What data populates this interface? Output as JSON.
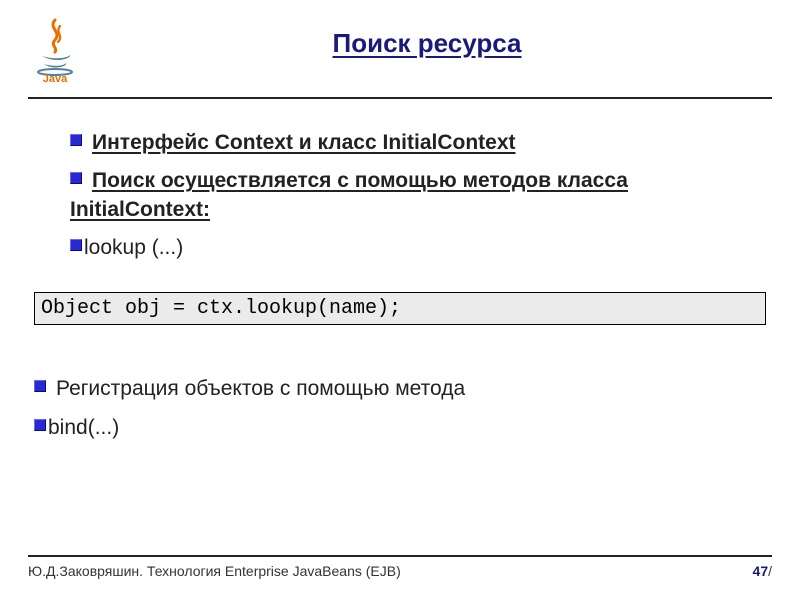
{
  "title": "Поиск ресурса",
  "bullets": {
    "b1": " Интерфейс Context и класс InitialContext",
    "b2a": " Поиск осуществляется с помощью методов класса",
    "b2b": "InitialContext:",
    "b3": "lookup (...)",
    "b4": " Регистрация объектов с помощью метода",
    "b5": "bind(...)"
  },
  "code": "Object obj = ctx.lookup(name);",
  "footer": {
    "author": "Ю.Д.Заковряшин. Технология Enterprise JavaBeans (EJB)",
    "page": "47",
    "sep": "/"
  },
  "logo_label": "Java"
}
